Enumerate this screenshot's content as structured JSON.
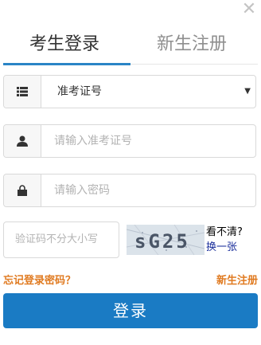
{
  "close_icon": "close-icon",
  "tabs": [
    {
      "label": "考生登录",
      "active": true
    },
    {
      "label": "新生注册",
      "active": false
    }
  ],
  "accent_color": "#2a85c6",
  "form": {
    "type_select": {
      "icon": "list-icon",
      "value": "准考证号"
    },
    "id_field": {
      "icon": "user-icon",
      "placeholder": "请输入准考证号"
    },
    "password_field": {
      "icon": "lock-icon",
      "placeholder": "请输入密码"
    },
    "captcha": {
      "placeholder": "验证码不分大小写",
      "image_text": "sG25",
      "unclear_label": "看不清?",
      "refresh_label": "换一张"
    }
  },
  "links": {
    "forgot_password": "忘记登录密码？",
    "register": "新生注册"
  },
  "login_button": "登录"
}
